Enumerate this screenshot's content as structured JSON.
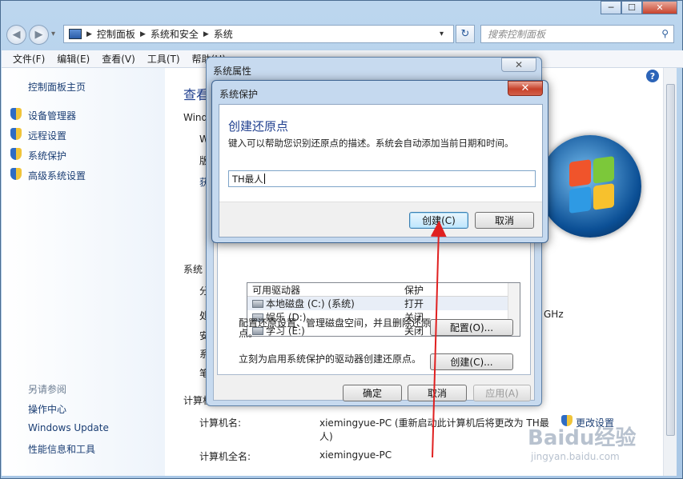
{
  "window": {
    "controls": {
      "minimize": "─",
      "maximize": "☐",
      "close": "✕"
    }
  },
  "nav": {
    "back": "◀",
    "forward": "▶",
    "dropdown": "▾",
    "breadcrumb": [
      "控制面板",
      "系统和安全",
      "系统"
    ],
    "crumb_sep": "▶",
    "address_dropdown": "▾",
    "refresh": "↻",
    "search_placeholder": "搜索控制面板",
    "search_icon": "⚲"
  },
  "menu": [
    "文件(F)",
    "编辑(E)",
    "查看(V)",
    "工具(T)",
    "帮助(H)"
  ],
  "sidebar": {
    "home": "控制面板主页",
    "links": [
      "设备管理器",
      "远程设置",
      "系统保护",
      "高级系统设置"
    ],
    "see_also": "另请参阅",
    "see_also_links": [
      "操作中心",
      "Windows Update",
      "性能信息和工具"
    ]
  },
  "main": {
    "heading": "查看",
    "windows_label": "Wind",
    "fragments": [
      "W",
      "版",
      "获"
    ],
    "system_label": "系统",
    "sys_fragments": [
      "分",
      "处",
      "安",
      "系",
      "笔"
    ],
    "ghz": "GHz",
    "computer_label": "计算机",
    "computer_name_label": "计算机名:",
    "computer_name_value": "xiemingyue-PC (重新启动此计算机后将更改为 TH最",
    "computer_name_value2": "人)",
    "computer_full_label": "计算机全名:",
    "computer_full_value": "xiemingyue-PC",
    "change_settings": "更改设置",
    "help": "?"
  },
  "sysprop": {
    "title": "系统属性",
    "close": "✕",
    "drive_header": [
      "可用驱动器",
      "保护"
    ],
    "drives": [
      {
        "name": "本地磁盘 (C:) (系统)",
        "status": "打开"
      },
      {
        "name": "娱乐 (D:)",
        "status": "关闭"
      },
      {
        "name": "学习 (E:)",
        "status": "关闭"
      }
    ],
    "config_text": "配置还原设置、管理磁盘空间，并且删除还原点。",
    "config_button": "配置(O)...",
    "create_text": "立刻为启用系统保护的驱动器创建还原点。",
    "create_button": "创建(C)...",
    "ok": "确定",
    "cancel": "取消",
    "apply": "应用(A)"
  },
  "restore_dialog": {
    "title": "系统保护",
    "close": "✕",
    "heading": "创建还原点",
    "description": "键入可以帮助您识别还原点的描述。系统会自动添加当前日期和时间。",
    "input_value": "TH最人",
    "create_button": "创建(C)",
    "cancel_button": "取消"
  },
  "watermark": {
    "brand": "Baidu经验",
    "url": "jingyan.baidu.com"
  },
  "colors": {
    "link": "#1b3e74",
    "heading": "#1e3e8e",
    "arrow": "#e02020"
  }
}
